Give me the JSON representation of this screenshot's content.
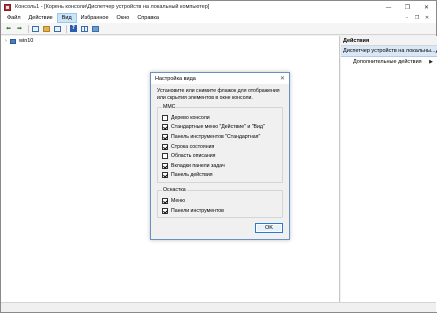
{
  "window": {
    "title": "Консоль1 - [Корень консоли\\Диспетчер устройств на локальный компьютер]",
    "controls": {
      "minimize": "—",
      "restore": "❐",
      "close": "✕"
    }
  },
  "menu": {
    "items": [
      "Файл",
      "Действие",
      "Вид",
      "Избранное",
      "Окно",
      "Справка"
    ],
    "active": "Вид",
    "mdi_controls": {
      "minimize": "–",
      "restore": "❐",
      "close": "✕"
    }
  },
  "toolbar": {
    "back_icon": "arrow-left-icon",
    "forward_icon": "arrow-right-icon",
    "back_glyph": "⬅",
    "forward_glyph": "➡",
    "help_glyph": "?"
  },
  "tree": {
    "expander": "›",
    "node_label": "win10"
  },
  "actions": {
    "header": "Действия",
    "group_label": "Диспетчер устройств на локальны...",
    "group_chevron": "▲",
    "item_label": "Дополнительные действия",
    "item_arrow": "▶"
  },
  "dialog": {
    "title": "Настройка вида",
    "close_glyph": "✕",
    "description": "Установите или снимите флажок для отображения или скрытия элементов в окне консоли.",
    "mmc_group": {
      "label": "ММС",
      "options": [
        {
          "label": "Дерево консоли",
          "checked": false
        },
        {
          "label": "Стандартные меню \"Действие\" и \"Вид\"",
          "checked": true
        },
        {
          "label": "Панель инструментов \"Стандартная\"",
          "checked": true
        },
        {
          "label": "Строка состояния",
          "checked": true
        },
        {
          "label": "Область описания",
          "checked": false
        },
        {
          "label": "Вкладки панели задач",
          "checked": true
        },
        {
          "label": "Панель действия",
          "checked": true
        }
      ]
    },
    "snapin_group": {
      "label": "Оснастка",
      "options": [
        {
          "label": "Меню",
          "checked": true
        },
        {
          "label": "Панели инструментов",
          "checked": true
        }
      ]
    },
    "ok_label": "OK"
  },
  "colors": {
    "accent": "#2b79d6",
    "selection": "#cce4f7",
    "actions_group_bg": "#d9e7f6"
  }
}
